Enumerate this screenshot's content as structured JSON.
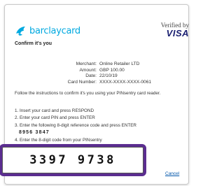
{
  "brand": {
    "name": "barclaycard"
  },
  "verified_by_visa": {
    "line1": "Verified by",
    "line2": "VISA"
  },
  "title": "Confirm it's you",
  "details": [
    {
      "label": "Merchant:",
      "value": "Online Retailer LTD"
    },
    {
      "label": "Amount:",
      "value": "GBP 100.00"
    },
    {
      "label": "Date:",
      "value": "22/10/19"
    },
    {
      "label": "Card Number:",
      "value": "XXXX-XXXX-XXXX-0061"
    }
  ],
  "instructions": "Follow the instructions to confirm it's you using your PINsentry card reader.",
  "steps": [
    "1. Insert your card and press RESPOND",
    "2. Enter your card PIN and press ENTER",
    "3. Enter the following 8-digit reference code and press ENTER",
    "4. Enter the 8-digit code from your PINsentry"
  ],
  "reference_code": "8956 3847",
  "code_input": {
    "value": "3397 9738"
  },
  "cancel_label": "Cancel",
  "colors": {
    "brand": "#00a9e0",
    "highlight": "#5b2d90",
    "visa": "#1a1f71"
  }
}
